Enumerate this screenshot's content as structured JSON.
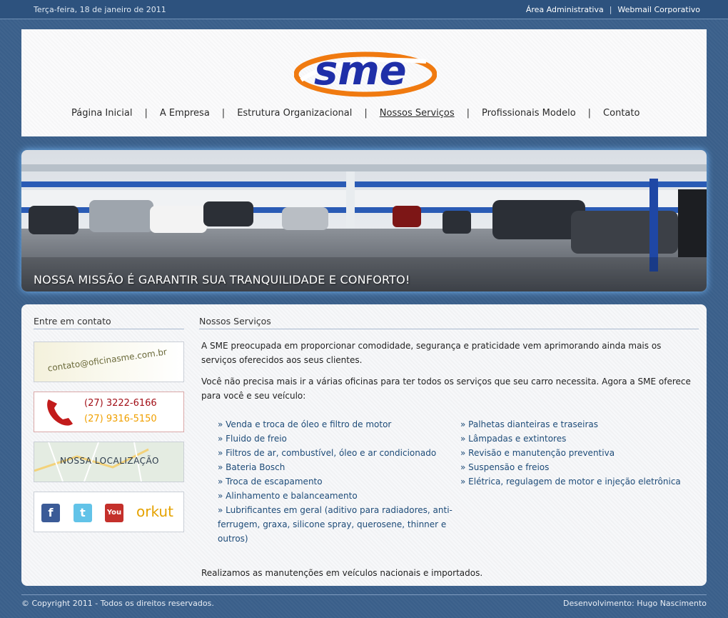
{
  "topbar": {
    "date": "Terça-feira, 18 de janeiro de 2011",
    "admin_link": "Área Administrativa",
    "separator": "|",
    "webmail_link": "Webmail Corporativo"
  },
  "header": {
    "logo_text": "sme",
    "nav": [
      {
        "label": "Página Inicial"
      },
      {
        "label": "A Empresa"
      },
      {
        "label": "Estrutura Organizacional"
      },
      {
        "label": "Nossos Serviços"
      },
      {
        "label": "Profissionais Modelo"
      },
      {
        "label": "Contato"
      }
    ],
    "nav_separator": "|",
    "active_nav": "Nossos Serviços"
  },
  "banner": {
    "caption": "NOSSA MISSÃO É GARANTIR SUA TRANQUILIDADE E CONFORTO!"
  },
  "sidebar": {
    "title": "Entre em contato",
    "email": "contato@oficinasme.com.br",
    "phone1": "(27) 3222-6166",
    "phone2": "(27) 9316-5150",
    "location": "NOSSA LOCALIZAÇÃO",
    "social": {
      "facebook": "f",
      "twitter": "t",
      "youtube": "You",
      "orkut": "orkut"
    }
  },
  "main": {
    "title": "Nossos Serviços",
    "intro1": "A SME preocupada em proporcionar comodidade, segurança e praticidade vem aprimorando ainda mais os serviços oferecidos aos seus clientes.",
    "intro2": "Você não precisa mais ir a várias oficinas para ter todos os serviços que seu carro necessita. Agora a SME oferece para você e seu veículo:",
    "services_col1": [
      "» Venda e troca de óleo e filtro de motor",
      "» Fluido de freio",
      "» Filtros de ar, combustível, óleo e ar condicionado",
      "» Bateria Bosch",
      "» Troca de escapamento",
      "» Alinhamento e balanceamento",
      "» Lubrificantes em geral (aditivo para radiadores, anti-ferrugem, graxa, silicone spray, querosene, thinner e outros)"
    ],
    "services_col2": [
      "» Palhetas dianteiras e traseiras",
      "» Lâmpadas e extintores",
      "» Revisão e manutenção preventiva",
      "» Suspensão e freios",
      "» Elétrica, regulagem de motor e injeção eletrônica"
    ],
    "closing": "Realizamos as manutenções em veículos nacionais e importados."
  },
  "footer": {
    "copyright": "© Copyright 2011 - Todos os direitos reservados.",
    "credit": "Desenvolvimento: Hugo Nascimento"
  },
  "colors": {
    "background": "#3a5f8a",
    "logo_blue": "#1f2fa8",
    "logo_orange": "#f07a10",
    "link_blue": "#1d4b78"
  }
}
